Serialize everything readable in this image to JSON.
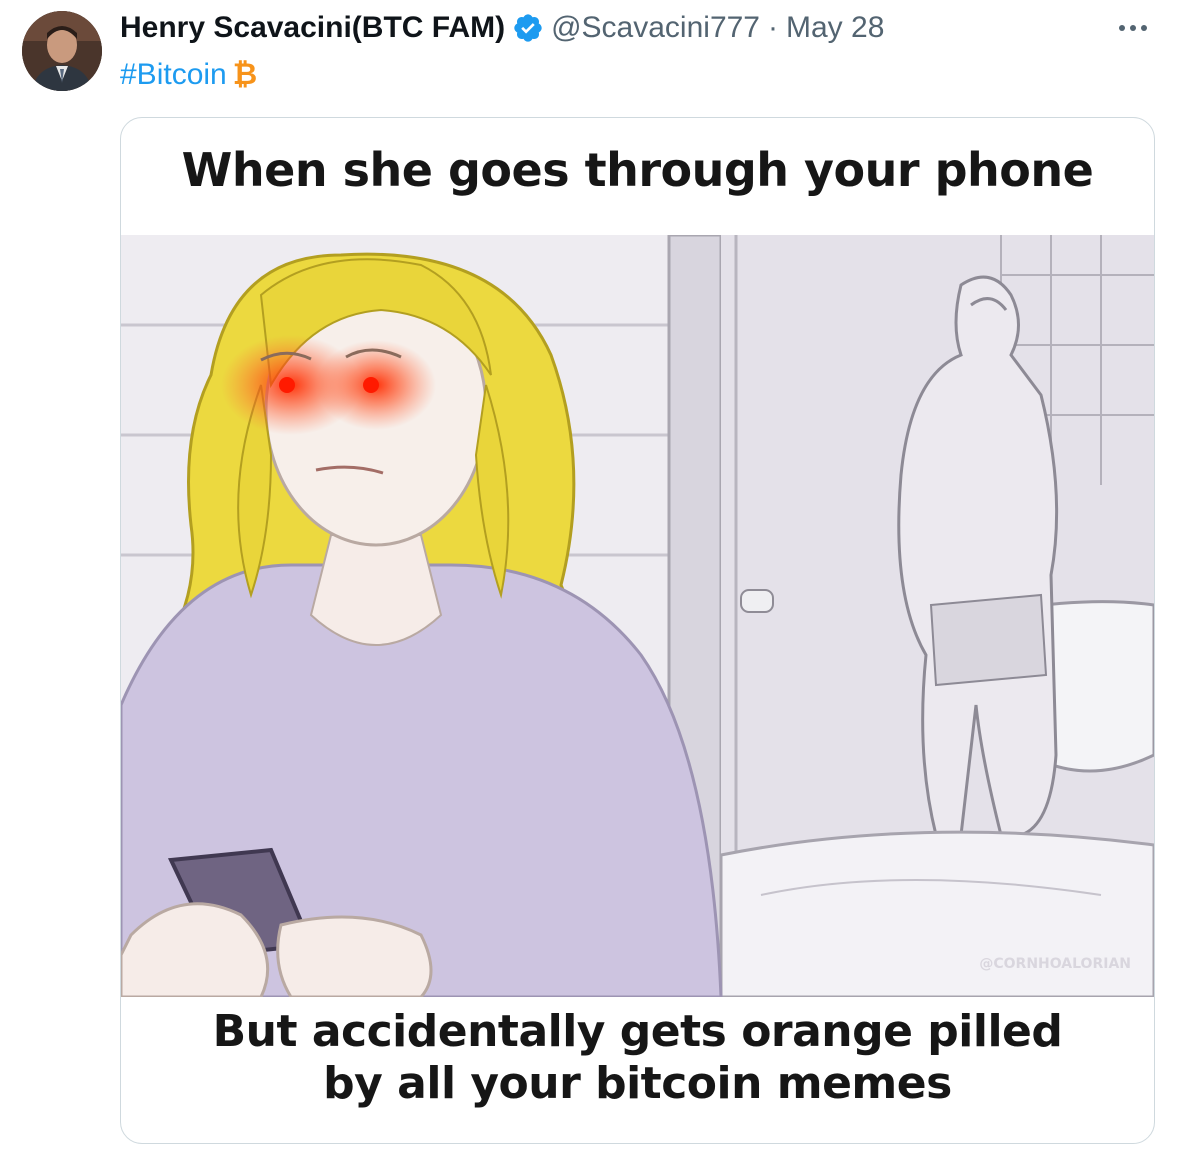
{
  "tweet": {
    "author_name": "Henry Scavacini(BTC FAM)",
    "handle": "@Scavacini777",
    "separator": "·",
    "date": "May 28",
    "more_label": "···",
    "hashtag": "#Bitcoin",
    "hashtag_emoji": "₿"
  },
  "meme": {
    "top_text": "When she goes through your phone",
    "bottom_line_1": "But accidentally gets orange pilled",
    "bottom_line_2": "by all your bitcoin memes",
    "watermark": "@CORNHOALORIAN"
  },
  "colors": {
    "link": "#1d9bf0",
    "verified": "#1d9bf0",
    "bitcoin": "#f7931a",
    "secondary_text": "#536471",
    "card_border": "#cfd9de"
  },
  "icons": {
    "verified": "verified-badge-icon",
    "more": "more-horizontal-icon",
    "bitcoin": "bitcoin-icon"
  }
}
